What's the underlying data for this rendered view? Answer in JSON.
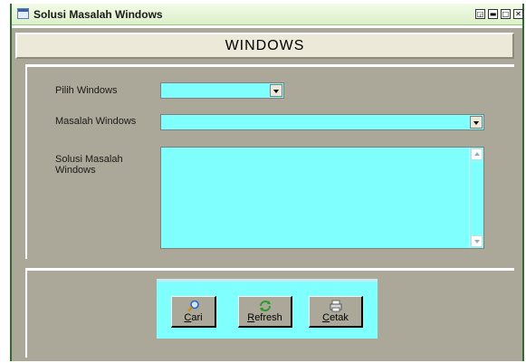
{
  "window": {
    "title": "Solusi Masalah Windows"
  },
  "header": {
    "title": "WINDOWS"
  },
  "form": {
    "pilih_label": "Pilih Windows",
    "pilih_value": "",
    "masalah_label": "Masalah Windows",
    "masalah_value": "",
    "solusi_label": "Solusi Masalah Windows",
    "solusi_value": ""
  },
  "buttons": {
    "cari": {
      "accel": "C",
      "rest": "ari",
      "icon": "search-icon"
    },
    "refresh": {
      "accel": "R",
      "rest": "efresh",
      "icon": "refresh-icon"
    },
    "cetak": {
      "accel": "C",
      "rest": "etak",
      "icon": "printer-icon"
    }
  },
  "colors": {
    "field": "#80ffff",
    "panel": "#aca899",
    "header": "#ece9d8"
  }
}
